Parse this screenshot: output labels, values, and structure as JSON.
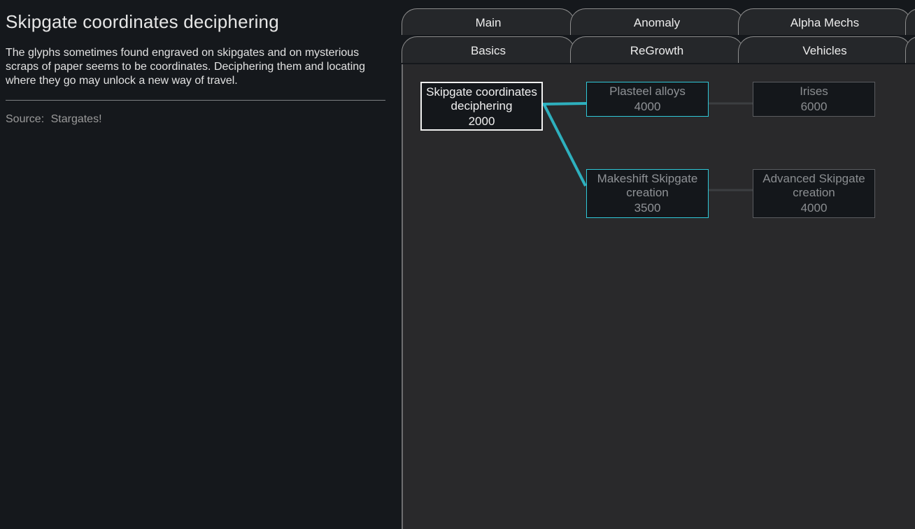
{
  "detail": {
    "title": "Skipgate coordinates deciphering",
    "description": "The glyphs sometimes found engraved on skipgates and on mysterious scraps of paper seems to be coordinates. Deciphering them and locating where they go may unlock a new way of travel.",
    "source_label": "Source:",
    "source_value": "Stargates!"
  },
  "tabs": {
    "row1": [
      "Main",
      "Anomaly",
      "Alpha Mechs"
    ],
    "row2": [
      "Basics",
      "ReGrowth",
      "Vehicles"
    ]
  },
  "tree": {
    "nodes": [
      {
        "id": "skipgate-coords",
        "name": "Skipgate coordinates deciphering",
        "cost": "2000",
        "state": "selected"
      },
      {
        "id": "plasteel",
        "name": "Plasteel alloys",
        "cost": "4000",
        "state": "available"
      },
      {
        "id": "irises",
        "name": "Irises",
        "cost": "6000",
        "state": "locked"
      },
      {
        "id": "makeshift",
        "name": "Makeshift Skipgate creation",
        "cost": "3500",
        "state": "available"
      },
      {
        "id": "advanced",
        "name": "Advanced Skipgate creation",
        "cost": "4000",
        "state": "locked"
      }
    ]
  },
  "colors": {
    "highlight_link": "#2fc8d8",
    "dim_link": "#3c3e41",
    "selected_border": "#f0f0f0"
  }
}
